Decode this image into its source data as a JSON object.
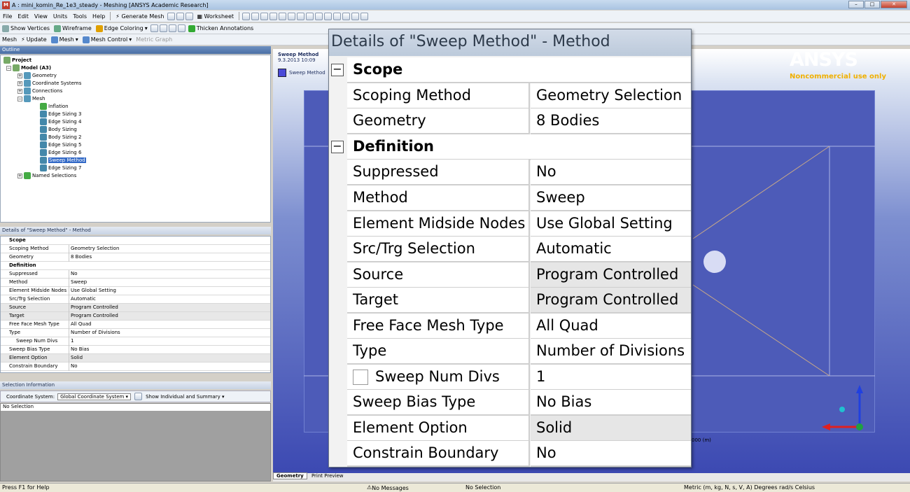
{
  "window": {
    "title": "A : mini_komin_Re_1e3_steady - Meshing [ANSYS Academic Research]",
    "app_icon": "M"
  },
  "menu": [
    "File",
    "Edit",
    "View",
    "Units",
    "Tools",
    "Help"
  ],
  "toolbar1": {
    "generate_mesh": "Generate Mesh",
    "worksheet": "Worksheet"
  },
  "toolbar2": {
    "show_vertices": "Show Vertices",
    "wireframe": "Wireframe",
    "edge_coloring": "Edge Coloring",
    "thicken": "Thicken Annotations",
    "show_mesh": "Show Mesh",
    "show_coord": "Show Coordinate Systems"
  },
  "toolbar3": {
    "mesh": "Mesh",
    "update": "Update",
    "mesh_menu": "Mesh",
    "mesh_control": "Mesh Control",
    "metric_graph": "Metric Graph"
  },
  "outline": {
    "title": "Outline",
    "items": [
      "Project",
      "Model (A3)",
      "Geometry",
      "Coordinate Systems",
      "Connections",
      "Mesh",
      "Inflation",
      "Edge Sizing 3",
      "Edge Sizing 4",
      "Body Sizing",
      "Body Sizing 2",
      "Edge Sizing 5",
      "Edge Sizing 6",
      "Sweep Method",
      "Edge Sizing 7",
      "Named Selections"
    ]
  },
  "details_small": {
    "title": "Details of \"Sweep Method\" - Method"
  },
  "details": {
    "title": "Details of \"Sweep Method\" - Method",
    "rows": [
      {
        "k": "Scope",
        "cat": true
      },
      {
        "k": "Scoping Method",
        "v": "Geometry Selection"
      },
      {
        "k": "Geometry",
        "v": "8 Bodies"
      },
      {
        "k": "Definition",
        "cat": true
      },
      {
        "k": "Suppressed",
        "v": "No"
      },
      {
        "k": "Method",
        "v": "Sweep"
      },
      {
        "k": "Element Midside Nodes",
        "v": "Use Global Setting"
      },
      {
        "k": "Src/Trg Selection",
        "v": "Automatic"
      },
      {
        "k": "Source",
        "v": "Program Controlled",
        "gray": true
      },
      {
        "k": "Target",
        "v": "Program Controlled",
        "gray": true
      },
      {
        "k": "Free Face Mesh Type",
        "v": "All Quad"
      },
      {
        "k": "Type",
        "v": "Number of Divisions"
      },
      {
        "k": "Sweep Num Divs",
        "v": "1",
        "check": true
      },
      {
        "k": "Sweep Bias Type",
        "v": "No Bias"
      },
      {
        "k": "Element Option",
        "v": "Solid",
        "gray": true
      },
      {
        "k": "Constrain Boundary",
        "v": "No"
      }
    ]
  },
  "selection": {
    "title": "Selection Information",
    "coord_label": "Coordinate System:",
    "coord_value": "Global Coordinate System",
    "show": "Show Individual and Summary",
    "status": "No Selection"
  },
  "viewport": {
    "label": "Sweep Method",
    "date": "9.3.2013 10:09",
    "legend": "Sweep Method",
    "scale": "000 (m)",
    "brand": "ANSYS",
    "brand_sub": "Noncommercial use only"
  },
  "tabs": [
    "Geometry",
    "Print Preview"
  ],
  "status": {
    "help": "Press F1 for Help",
    "messages": "No Messages",
    "selection": "No Selection",
    "units": "Metric (m, kg, N, s, V, A)  Degrees  rad/s  Celsius"
  }
}
